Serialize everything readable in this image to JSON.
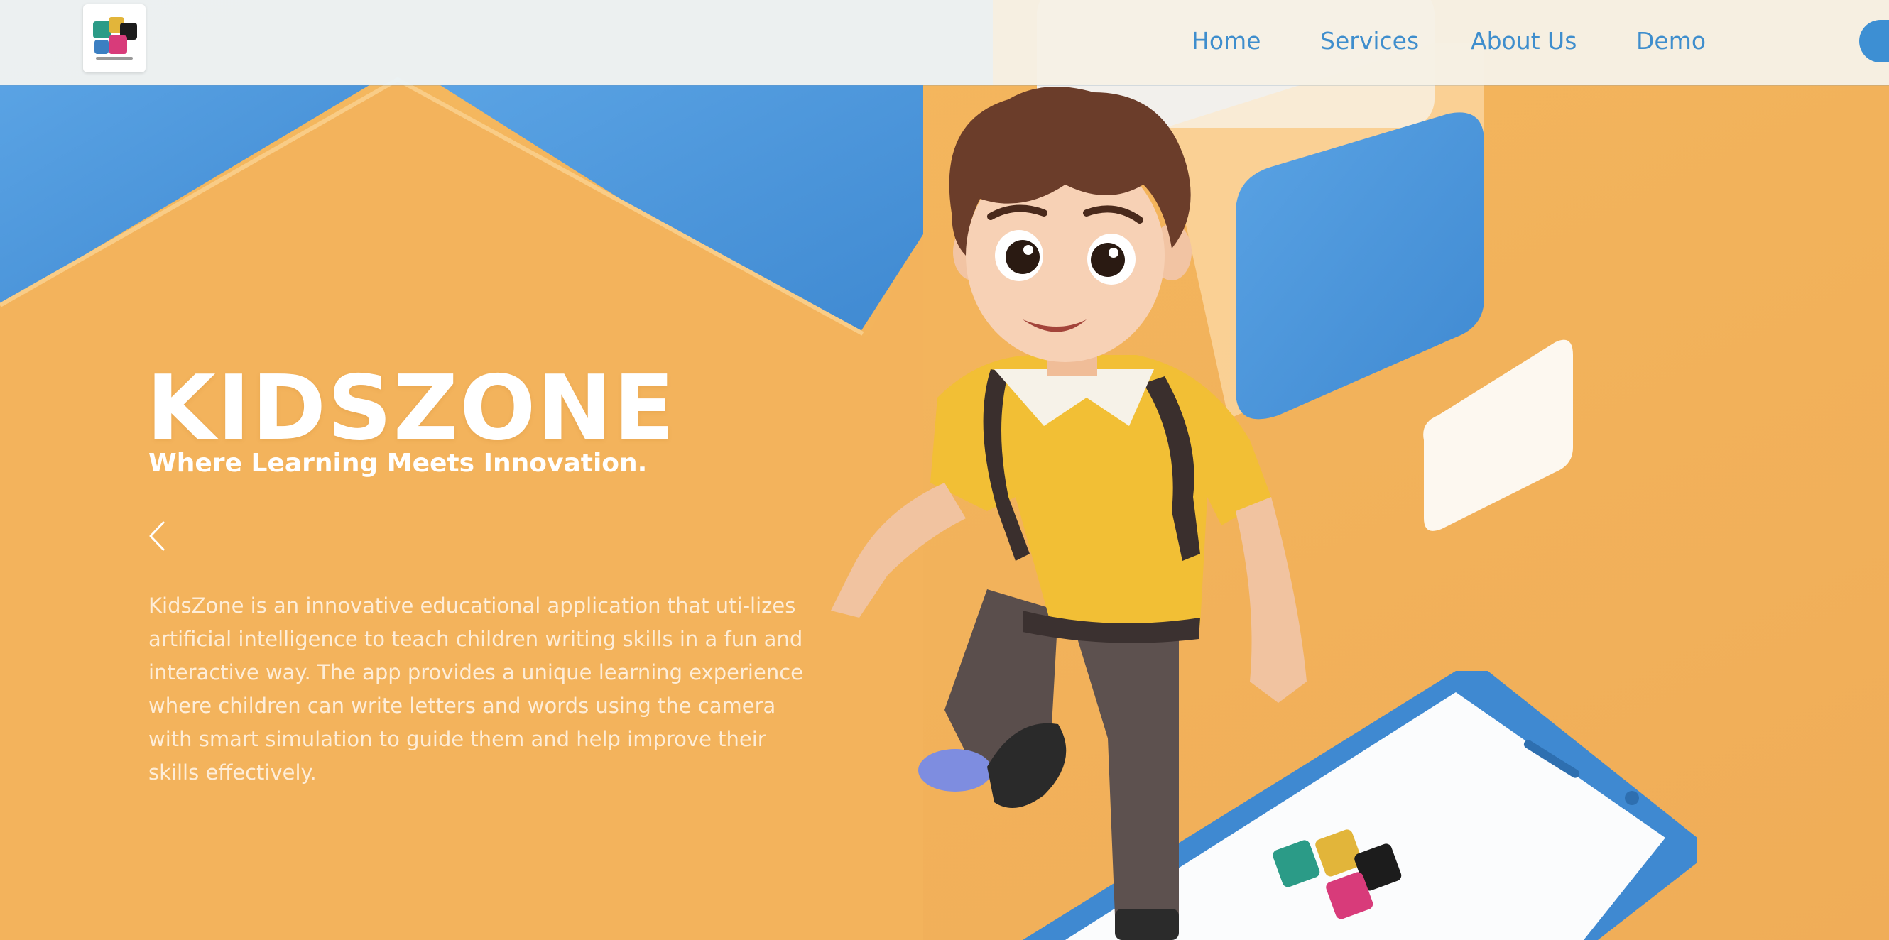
{
  "nav": {
    "logo_icon": "kidszone-puzzle-logo",
    "links": [
      "Home",
      "Services",
      "About Us",
      "Demo"
    ]
  },
  "hero": {
    "title": "KIDSZONE",
    "tagline": "Where Learning Meets Innovation.",
    "description": "KidsZone is an innovative educational application that uti-lizes artificial intelligence to teach children writing skills in a fun and interactive way. The app provides a unique learning experience where children can write letters and words using the camera with smart simulation to guide them and help improve their skills effectively.",
    "prev_icon": "chevron-left-icon"
  },
  "colors": {
    "background": "#f3b45e",
    "accent_blue": "#4a93d8",
    "nav_text": "#3f8ecd"
  }
}
